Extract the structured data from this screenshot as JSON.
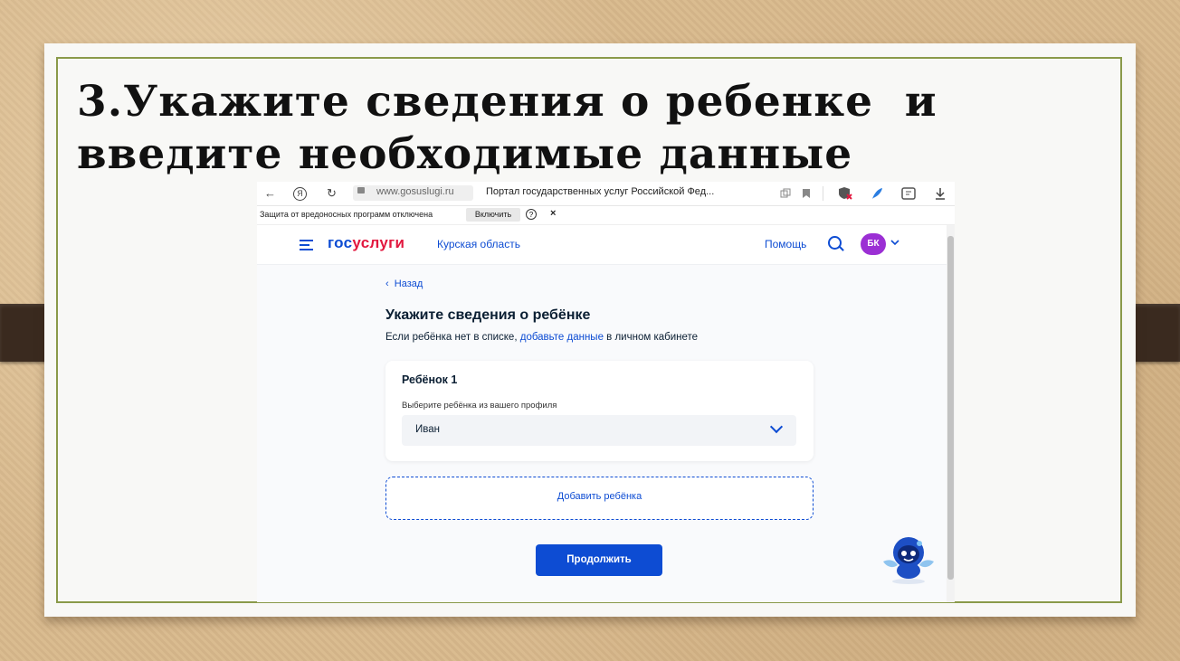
{
  "slide": {
    "title_line1": "3.Укажите сведения о ребенке  и",
    "title_line2": "введите необходимые данные"
  },
  "browser": {
    "back_glyph": "←",
    "yandex_glyph": "Я",
    "reload_glyph": "↻",
    "url": "www.gosuslugi.ru",
    "page_title": "Портал государственных услуг Российской Фед...",
    "warning_text": "Защита от вредоносных программ отключена",
    "enable_label": "Включить",
    "help_glyph": "?",
    "close_glyph": "×"
  },
  "header": {
    "logo_part1": "гос",
    "logo_part2": "услуги",
    "region": "Курская область",
    "help": "Помощь",
    "avatar_initials": "БК"
  },
  "main": {
    "back_link": "‹  Назад",
    "title": "Укажите сведения о ребёнке",
    "subtitle_before": "Если ребёнка нет в списке, ",
    "subtitle_link": "добавьте данные",
    "subtitle_after": " в личном кабинете",
    "child_card": {
      "title": "Ребёнок 1",
      "field_label": "Выберите ребёнка из вашего профиля",
      "selected_value": "Иван"
    },
    "add_child": "Добавить ребёнка",
    "continue": "Продолжить"
  },
  "colors": {
    "primary": "#0d4cd3",
    "brand_red": "#e2183f",
    "avatar": "#9b2fd4",
    "frame": "#8a9a4a"
  }
}
